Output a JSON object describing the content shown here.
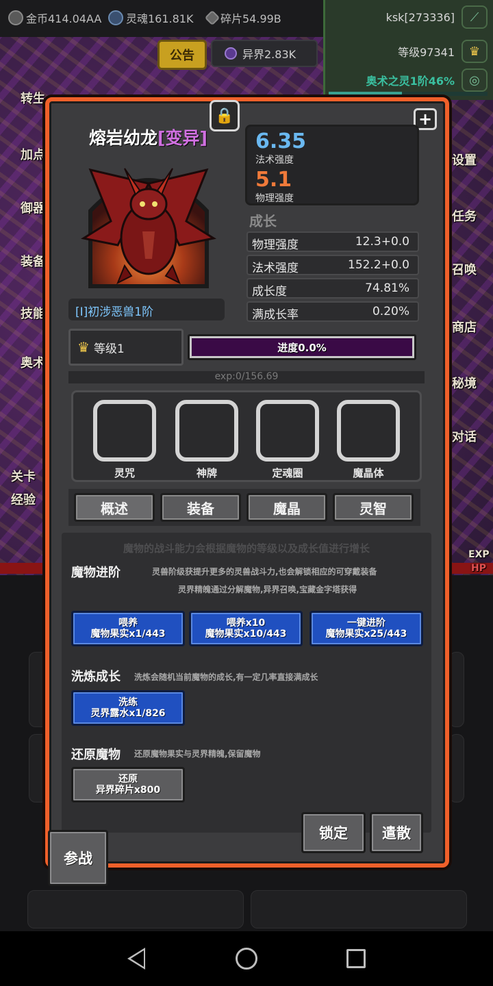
{
  "topbar": {
    "gold": "金币414.04AA",
    "soul": "灵魂161.81K",
    "shard": "碎片54.99B",
    "player": "ksk[273336]",
    "level": "等级97341",
    "arcane": "奥术之灵1阶46%",
    "arcane_progress": 0.46,
    "notice": "公告",
    "otherworld": "异界2.83K"
  },
  "background": {
    "left_labels": [
      "转生",
      "加点",
      "御器",
      "装备",
      "技能",
      "奥术",
      "关卡",
      "经验"
    ],
    "right_labels": [
      "设置",
      "任务",
      "召唤",
      "商店",
      "秘境",
      "对话"
    ],
    "exp": "EXP",
    "hp": "HP"
  },
  "pet": {
    "name": "熔岩幼龙",
    "mutation": "[变异]",
    "tier": "[I]初涉恶兽1阶",
    "magic_power": "6.35",
    "magic_power_label": "法术强度",
    "physical_power": "5.1",
    "physical_power_label": "物理强度",
    "magic_color": "#6ab8f0",
    "physical_color": "#f07a3a"
  },
  "growth": {
    "title": "成长",
    "rows": [
      {
        "label": "物理强度",
        "value": "12.3+0.0"
      },
      {
        "label": "法术强度",
        "value": "152.2+0.0"
      },
      {
        "label": "成长度",
        "value": "74.81%"
      },
      {
        "label": "满成长率",
        "value": "0.20%"
      }
    ]
  },
  "level": {
    "label": "等级1",
    "progress_label": "进度0.0%",
    "progress": 0.0,
    "exp": "exp:0/156.69"
  },
  "slots": [
    "灵咒",
    "神牌",
    "定魂圈",
    "魔晶体"
  ],
  "tabs": [
    "概述",
    "装备",
    "魔晶",
    "灵智"
  ],
  "overview": {
    "description": "魔物的战斗能力会根据魔物的等级以及成长值进行增长",
    "advance": {
      "title": "魔物进阶",
      "note_line1": "灵兽阶级获提升更多的灵兽战斗力,也会解锁相应的可穿戴装备",
      "note_line2": "灵界精魄通过分解魔物,异界召唤,宝藏金字塔获得",
      "buttons": [
        {
          "line1": "喂养",
          "line2": "魔物果实x1/443"
        },
        {
          "line1": "喂养x10",
          "line2": "魔物果实x10/443"
        },
        {
          "line1": "一键进阶",
          "line2": "魔物果实x25/443"
        }
      ]
    },
    "refine": {
      "title": "洗炼成长",
      "note": "洗炼会随机当前魔物的成长,有一定几率直接满成长",
      "button_line1": "洗练",
      "button_line2": "灵界露水x1/826"
    },
    "restore": {
      "title": "还原魔物",
      "note": "还原魔物果实与灵界精魄,保留魔物",
      "button_line1": "还原",
      "button_line2": "异界碎片x800"
    }
  },
  "actions": {
    "lock": "锁定",
    "dismiss": "遣散",
    "battle": "参战"
  }
}
